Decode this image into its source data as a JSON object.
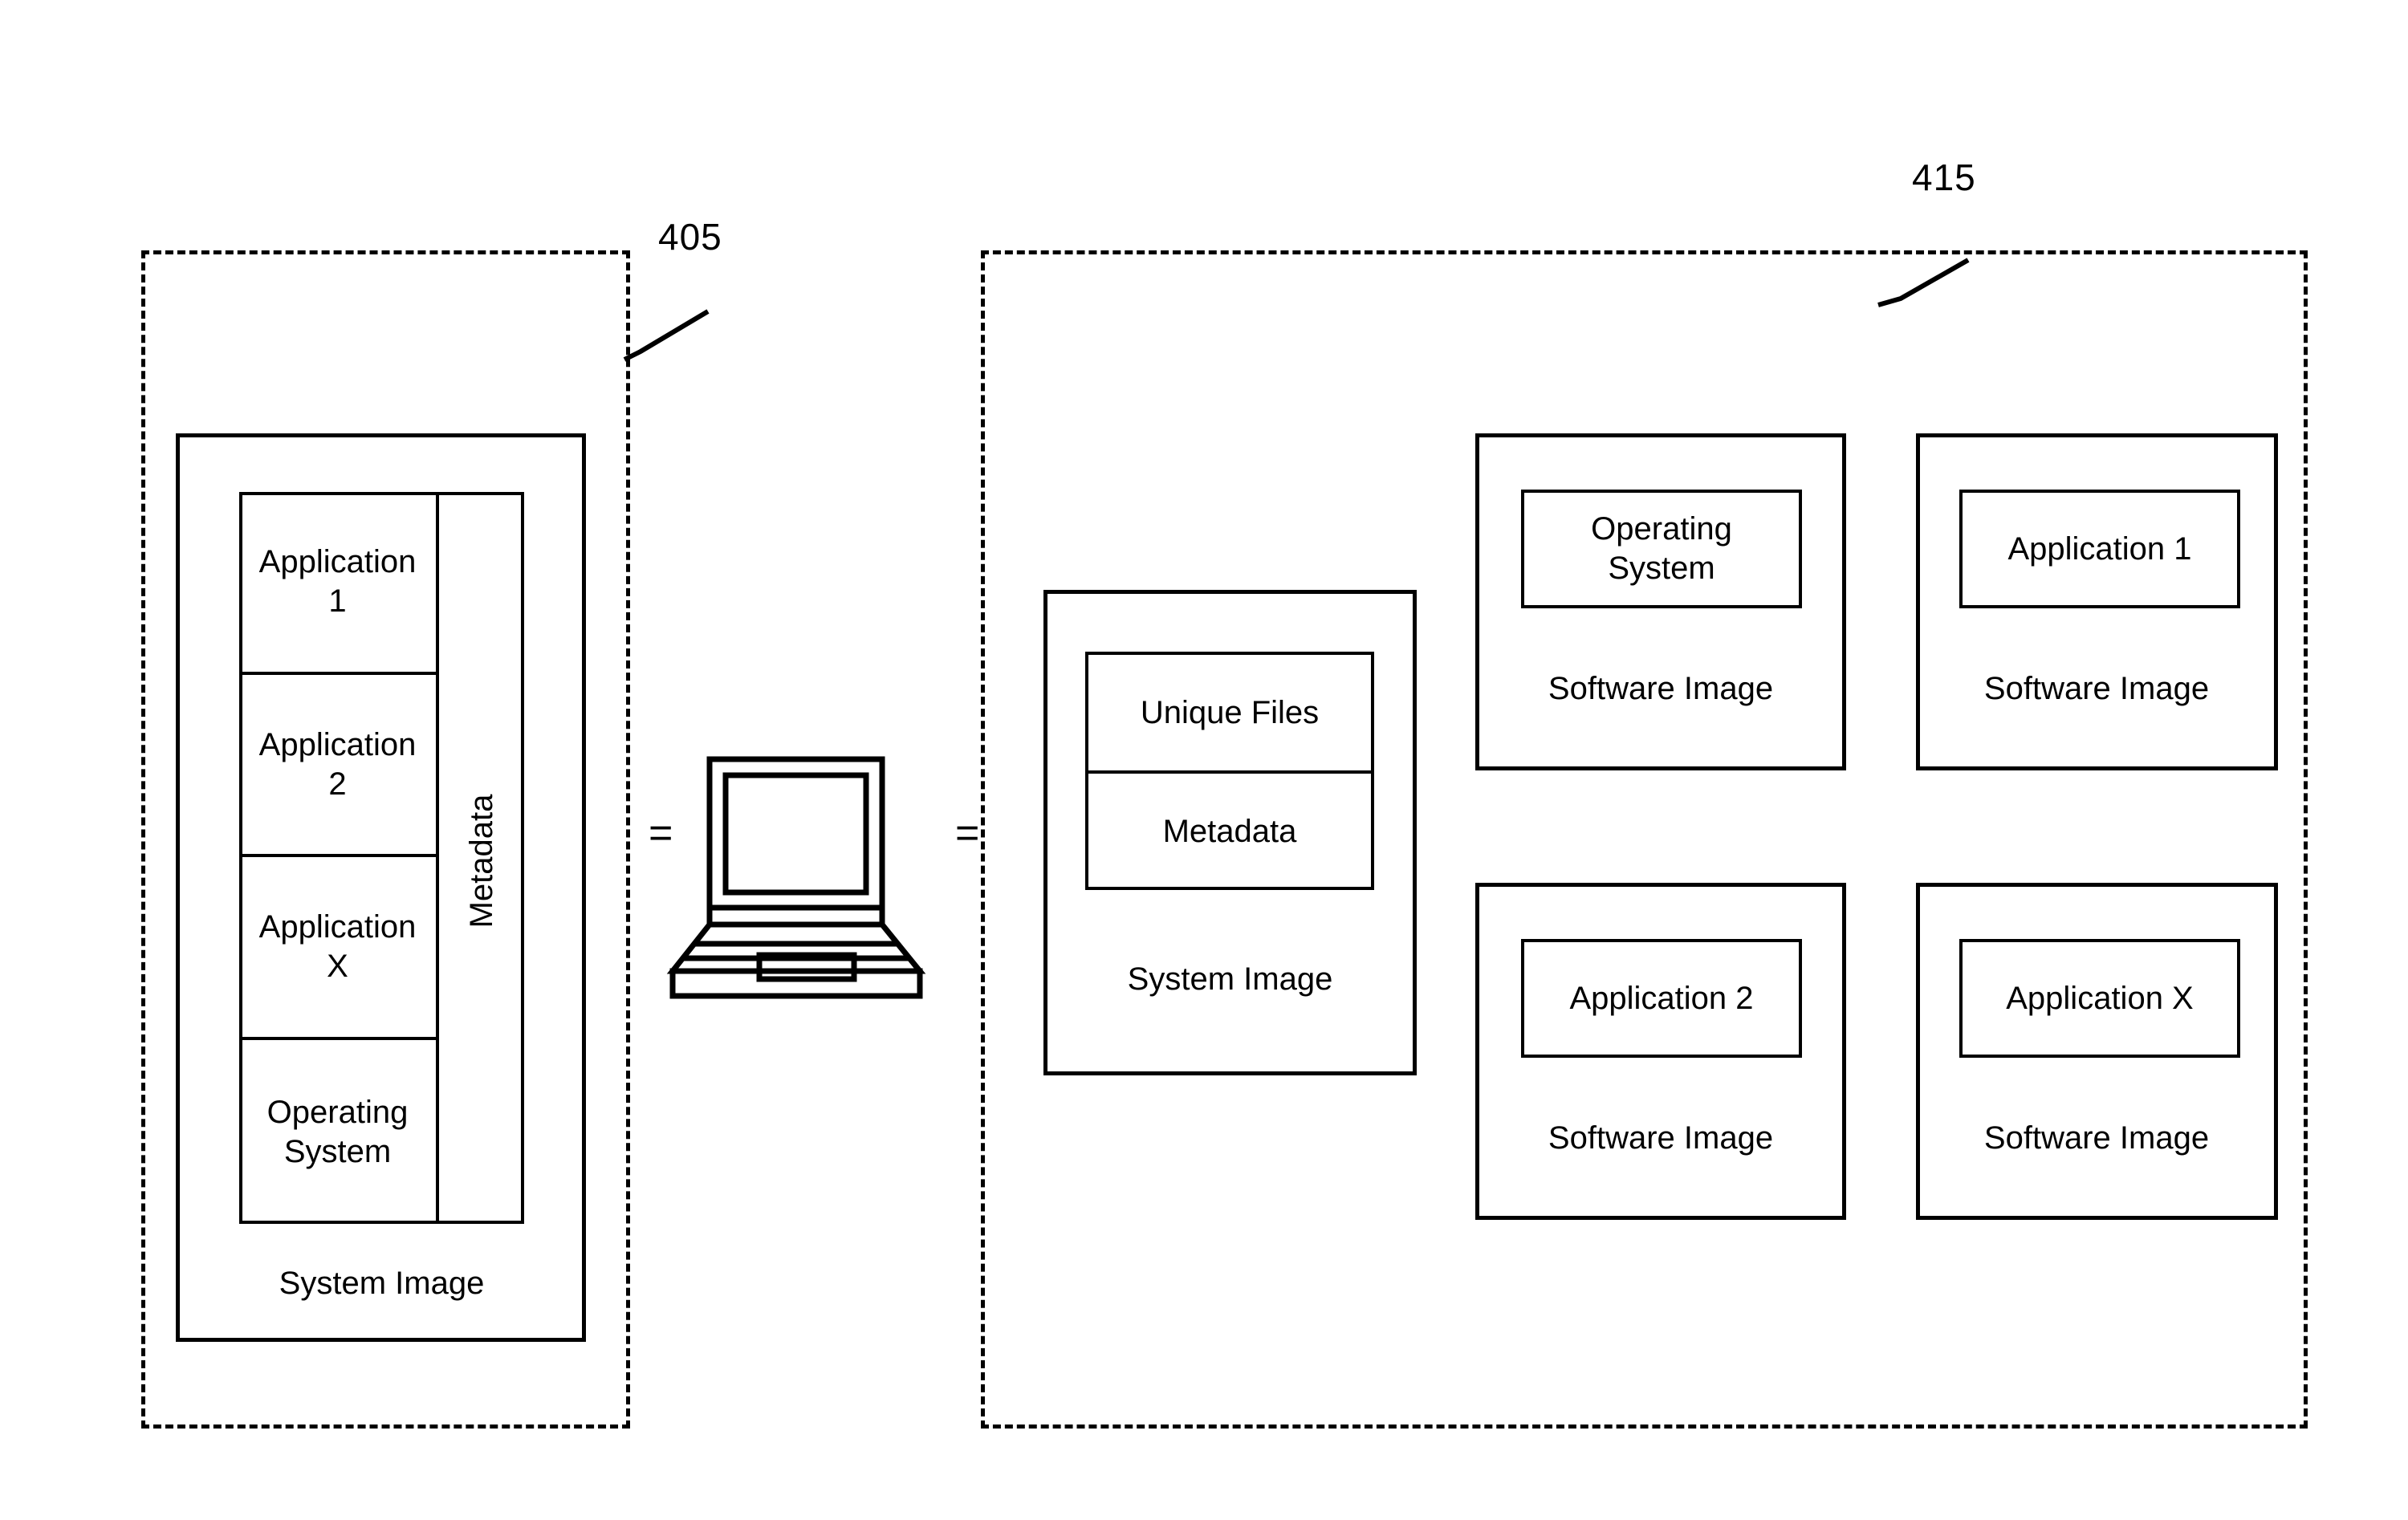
{
  "figure": {
    "left_group": {
      "ref_number": "405",
      "container_label": "System Image",
      "stack_items": [
        "Application\n1",
        "Application\n2",
        "Application\nX",
        "Operating\nSystem"
      ],
      "metadata_label": "Metadata"
    },
    "equals_left": "=",
    "equals_right": "=",
    "device_icon": "laptop-icon",
    "right_group": {
      "ref_number": "415",
      "system_image": {
        "container_label": "System Image",
        "rows": [
          "Unique Files",
          "Metadata"
        ]
      },
      "software_images": [
        {
          "inner_label": "Operating\nSystem",
          "caption": "Software Image"
        },
        {
          "inner_label": "Application 1",
          "caption": "Software Image"
        },
        {
          "inner_label": "Application 2",
          "caption": "Software Image"
        },
        {
          "inner_label": "Application X",
          "caption": "Software Image"
        }
      ]
    }
  },
  "colors": {
    "stroke": "#000000",
    "background": "#ffffff"
  }
}
